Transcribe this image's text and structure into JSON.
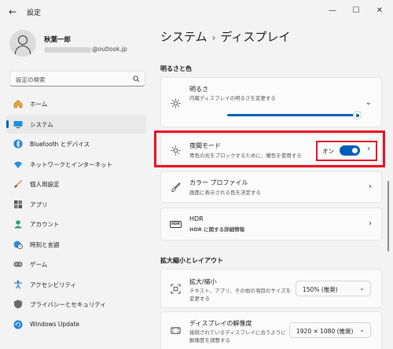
{
  "app": {
    "title": "設定"
  },
  "window_controls": {
    "minimize": "—",
    "maximize": "☐",
    "close": "✕"
  },
  "user": {
    "name": "秋葉一郎",
    "email_suffix": "@outlook.jp"
  },
  "search": {
    "placeholder": "設定の検索"
  },
  "sidebar": {
    "items": [
      {
        "label": "ホーム",
        "icon": "home-icon"
      },
      {
        "label": "システム",
        "icon": "system-icon",
        "active": true
      },
      {
        "label": "Bluetooth とデバイス",
        "icon": "bluetooth-icon"
      },
      {
        "label": "ネットワークとインターネット",
        "icon": "wifi-icon"
      },
      {
        "label": "個人用設定",
        "icon": "brush-icon"
      },
      {
        "label": "アプリ",
        "icon": "apps-icon"
      },
      {
        "label": "アカウント",
        "icon": "account-icon"
      },
      {
        "label": "時刻と言語",
        "icon": "globe-clock-icon"
      },
      {
        "label": "ゲーム",
        "icon": "gamepad-icon"
      },
      {
        "label": "アクセシビリティ",
        "icon": "accessibility-icon"
      },
      {
        "label": "プライバシーとセキュリティ",
        "icon": "shield-icon"
      },
      {
        "label": "Windows Update",
        "icon": "update-icon"
      }
    ]
  },
  "breadcrumb": {
    "parent": "システム",
    "separator": "›",
    "current": "ディスプレイ"
  },
  "sections": {
    "brightness_color": "明るさと色",
    "scale_layout": "拡大縮小とレイアウト"
  },
  "cards": {
    "brightness": {
      "title": "明るさ",
      "subtitle": "内蔵ディスプレイの明るさを変更する",
      "slider_value": 100
    },
    "night_light": {
      "title": "夜間モード",
      "subtitle": "青色の光をブロックするために、暖色を使用する",
      "toggle_label": "オン",
      "toggle_on": true
    },
    "color_profile": {
      "title": "カラー プロファイル",
      "subtitle": "画面に表示される色を決定する"
    },
    "hdr": {
      "title": "HDR",
      "link": "HDR に関する詳細情報",
      "badge": "HDR"
    },
    "scale": {
      "title": "拡大/縮小",
      "subtitle_1": "テキスト、アプリ、その他の項目のサイズを",
      "subtitle_2": "変更する",
      "value": "150% (推奨)"
    },
    "resolution": {
      "title": "ディスプレイの解像度",
      "subtitle_1": "接続されているディスプレイに合うように",
      "subtitle_2": "解像度を調整する",
      "value": "1920 × 1080 (推奨)"
    }
  },
  "colors": {
    "accent": "#005fb8",
    "highlight": "#e81123",
    "background": "#f3f3f3"
  }
}
